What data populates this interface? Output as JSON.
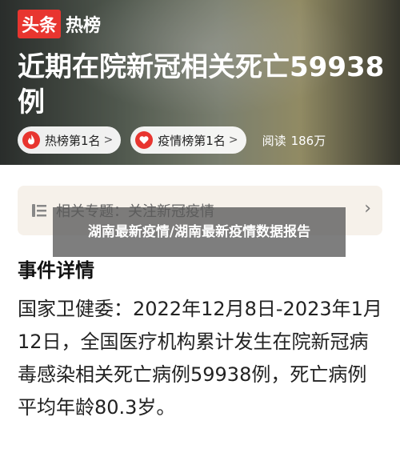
{
  "brand": {
    "badge": "头条",
    "label": "热榜"
  },
  "headline": "近期在院新冠相关死亡59938例",
  "chips": [
    {
      "label": "热榜第1名",
      "icon": "flame-icon"
    },
    {
      "label": "疫情榜第1名",
      "icon": "heart-icon"
    }
  ],
  "reads": {
    "label": "阅读",
    "count": "186万"
  },
  "topic": {
    "text": "相关专题：关注新冠疫情",
    "icon": "list-icon"
  },
  "overlay": {
    "text": "湖南最新疫情/湖南最新疫情数据报告"
  },
  "section_title": "事件详情",
  "body": "国家卫健委：2022年12月8日-2023年1月12日，全国医疗机构累计发生在院新冠病毒感染相关死亡病例59938例，死亡病例平均年龄80.3岁。",
  "colors": {
    "brand_red": "#e8352f",
    "accent_red": "#e8352f"
  }
}
